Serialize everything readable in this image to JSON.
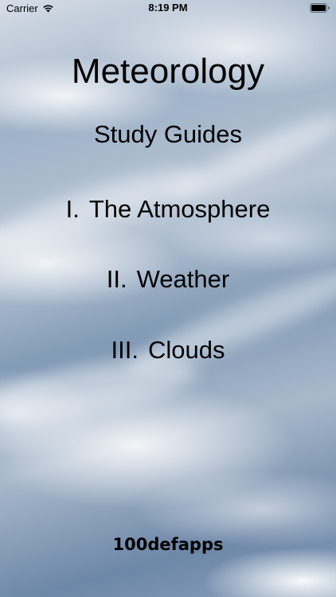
{
  "status_bar": {
    "carrier": "Carrier",
    "time": "8:19 PM",
    "wifi_icon": "wifi-icon",
    "battery_icon": "battery-icon"
  },
  "title": "Meteorology",
  "subtitle": "Study Guides",
  "menu": [
    {
      "numeral": "I.",
      "label": "The Atmosphere"
    },
    {
      "numeral": "II.",
      "label": "Weather"
    },
    {
      "numeral": "III.",
      "label": "Clouds"
    }
  ],
  "footer": "100defapps",
  "colors": {
    "text": "#000000",
    "sky_blue": "#7f98b5",
    "cloud_white": "#ffffff"
  }
}
